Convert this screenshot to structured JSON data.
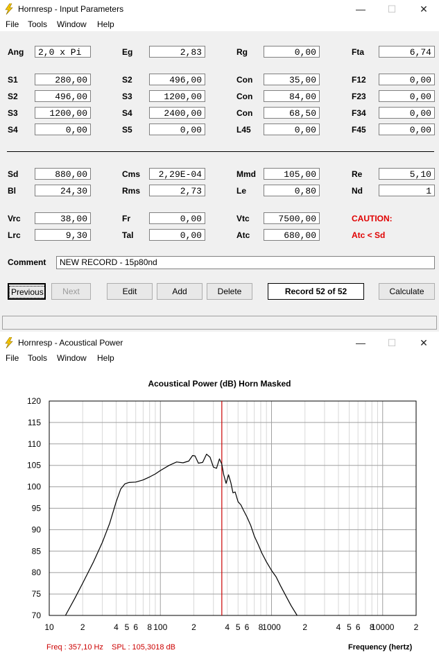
{
  "win1": {
    "title": "Hornresp - Input Parameters",
    "controls": {
      "min": "—",
      "max": "☐",
      "close": "✕"
    },
    "menu": [
      "File",
      "Tools",
      "Window",
      "Help"
    ],
    "rows": [
      [
        {
          "label": "Ang",
          "value": "2,0 x Pi",
          "align": "left"
        },
        {
          "label": "Eg",
          "value": "2,83"
        },
        {
          "label": "Rg",
          "value": "0,00"
        },
        {
          "label": "Fta",
          "value": "6,74"
        }
      ],
      [
        {
          "label": "S1",
          "value": "280,00"
        },
        {
          "label": "S2",
          "value": "496,00"
        },
        {
          "label": "Con",
          "value": "35,00"
        },
        {
          "label": "F12",
          "value": "0,00"
        }
      ],
      [
        {
          "label": "S2",
          "value": "496,00"
        },
        {
          "label": "S3",
          "value": "1200,00"
        },
        {
          "label": "Con",
          "value": "84,00"
        },
        {
          "label": "F23",
          "value": "0,00"
        }
      ],
      [
        {
          "label": "S3",
          "value": "1200,00"
        },
        {
          "label": "S4",
          "value": "2400,00"
        },
        {
          "label": "Con",
          "value": "68,50"
        },
        {
          "label": "F34",
          "value": "0,00"
        }
      ],
      [
        {
          "label": "S4",
          "value": "0,00"
        },
        {
          "label": "S5",
          "value": "0,00"
        },
        {
          "label": "L45",
          "value": "0,00"
        },
        {
          "label": "F45",
          "value": "0,00"
        }
      ],
      [
        {
          "label": "Sd",
          "value": "880,00"
        },
        {
          "label": "Cms",
          "value": "2,29E-04"
        },
        {
          "label": "Mmd",
          "value": "105,00"
        },
        {
          "label": "Re",
          "value": "5,10"
        }
      ],
      [
        {
          "label": "Bl",
          "value": "24,30"
        },
        {
          "label": "Rms",
          "value": "2,73"
        },
        {
          "label": "Le",
          "value": "0,80"
        },
        {
          "label": "Nd",
          "value": "1"
        }
      ],
      [
        {
          "label": "Vrc",
          "value": "38,00"
        },
        {
          "label": "Fr",
          "value": "0,00"
        },
        {
          "label": "Vtc",
          "value": "7500,00"
        },
        {
          "label": "CAUTION:",
          "value": null,
          "warn": true
        }
      ],
      [
        {
          "label": "Lrc",
          "value": "9,30"
        },
        {
          "label": "Tal",
          "value": "0,00"
        },
        {
          "label": "Atc",
          "value": "680,00"
        },
        {
          "label": "Atc < Sd",
          "value": null,
          "warn": true
        }
      ]
    ],
    "comment_label": "Comment",
    "comment_value": "NEW RECORD - 15p80nd",
    "buttons": {
      "previous": "Previous",
      "next": "Next",
      "edit": "Edit",
      "add": "Add",
      "delete": "Delete",
      "record": "Record 52 of 52",
      "calculate": "Calculate"
    }
  },
  "win2": {
    "title": "Hornresp - Acoustical Power",
    "controls": {
      "min": "—",
      "max": "☐",
      "close": "✕"
    },
    "menu": [
      "File",
      "Tools",
      "Window",
      "Help"
    ],
    "readout_freq": "Freq : 357,10 Hz",
    "readout_spl": "SPL : 105,3018 dB",
    "freq_label": "Frequency (hertz)"
  },
  "colors": {
    "accent": "#cc0000",
    "curve": "#000000",
    "grid_major": "#a0a0a0",
    "grid_minor": "#d8d8d8",
    "warning": "#e00000"
  },
  "chart_data": {
    "type": "line",
    "title": "Acoustical Power (dB)   Horn   Masked",
    "xlabel": "Frequency (hertz)",
    "ylabel": "",
    "x_scale": "log",
    "xlim": [
      10,
      20000
    ],
    "ylim": [
      70,
      120
    ],
    "x_tick_labels": [
      {
        "v": 10,
        "t": "10"
      },
      {
        "v": 20,
        "t": "2"
      },
      {
        "v": 40,
        "t": "4"
      },
      {
        "v": 50,
        "t": "5"
      },
      {
        "v": 60,
        "t": "6"
      },
      {
        "v": 80,
        "t": "8"
      },
      {
        "v": 100,
        "t": "100"
      },
      {
        "v": 200,
        "t": "2"
      },
      {
        "v": 400,
        "t": "4"
      },
      {
        "v": 500,
        "t": "5"
      },
      {
        "v": 600,
        "t": "6"
      },
      {
        "v": 800,
        "t": "8"
      },
      {
        "v": 1000,
        "t": "1000"
      },
      {
        "v": 2000,
        "t": "2"
      },
      {
        "v": 4000,
        "t": "4"
      },
      {
        "v": 5000,
        "t": "5"
      },
      {
        "v": 6000,
        "t": "6"
      },
      {
        "v": 8000,
        "t": "8"
      },
      {
        "v": 10000,
        "t": "10000"
      },
      {
        "v": 20000,
        "t": "2"
      }
    ],
    "y_ticks": [
      70,
      75,
      80,
      85,
      90,
      95,
      100,
      105,
      110,
      115,
      120
    ],
    "cursor_x": 357.1,
    "grid": true,
    "series": [
      {
        "points": [
          [
            14,
            70
          ],
          [
            17,
            74
          ],
          [
            20,
            77.5
          ],
          [
            25,
            82.5
          ],
          [
            30,
            87
          ],
          [
            35,
            91.5
          ],
          [
            40,
            96.5
          ],
          [
            44,
            99.5
          ],
          [
            48,
            100.7
          ],
          [
            52,
            101
          ],
          [
            60,
            101.1
          ],
          [
            70,
            101.6
          ],
          [
            80,
            102.3
          ],
          [
            90,
            103
          ],
          [
            100,
            103.8
          ],
          [
            120,
            105
          ],
          [
            140,
            105.8
          ],
          [
            160,
            105.6
          ],
          [
            180,
            106
          ],
          [
            195,
            107.3
          ],
          [
            205,
            107.2
          ],
          [
            220,
            105.5
          ],
          [
            240,
            105.7
          ],
          [
            260,
            107.6
          ],
          [
            280,
            106.9
          ],
          [
            300,
            104.6
          ],
          [
            320,
            104.3
          ],
          [
            340,
            106.5
          ],
          [
            357,
            105.3
          ],
          [
            370,
            103
          ],
          [
            390,
            100.8
          ],
          [
            410,
            102.8
          ],
          [
            430,
            101
          ],
          [
            450,
            98.6
          ],
          [
            470,
            98.8
          ],
          [
            500,
            96.5
          ],
          [
            530,
            95.8
          ],
          [
            560,
            94.5
          ],
          [
            600,
            93
          ],
          [
            650,
            91
          ],
          [
            700,
            88.5
          ],
          [
            760,
            86.5
          ],
          [
            820,
            84.5
          ],
          [
            900,
            82.5
          ],
          [
            1000,
            80.5
          ],
          [
            1100,
            79
          ],
          [
            1200,
            77
          ],
          [
            1350,
            74.5
          ],
          [
            1500,
            72.3
          ],
          [
            1700,
            70
          ]
        ]
      }
    ]
  }
}
